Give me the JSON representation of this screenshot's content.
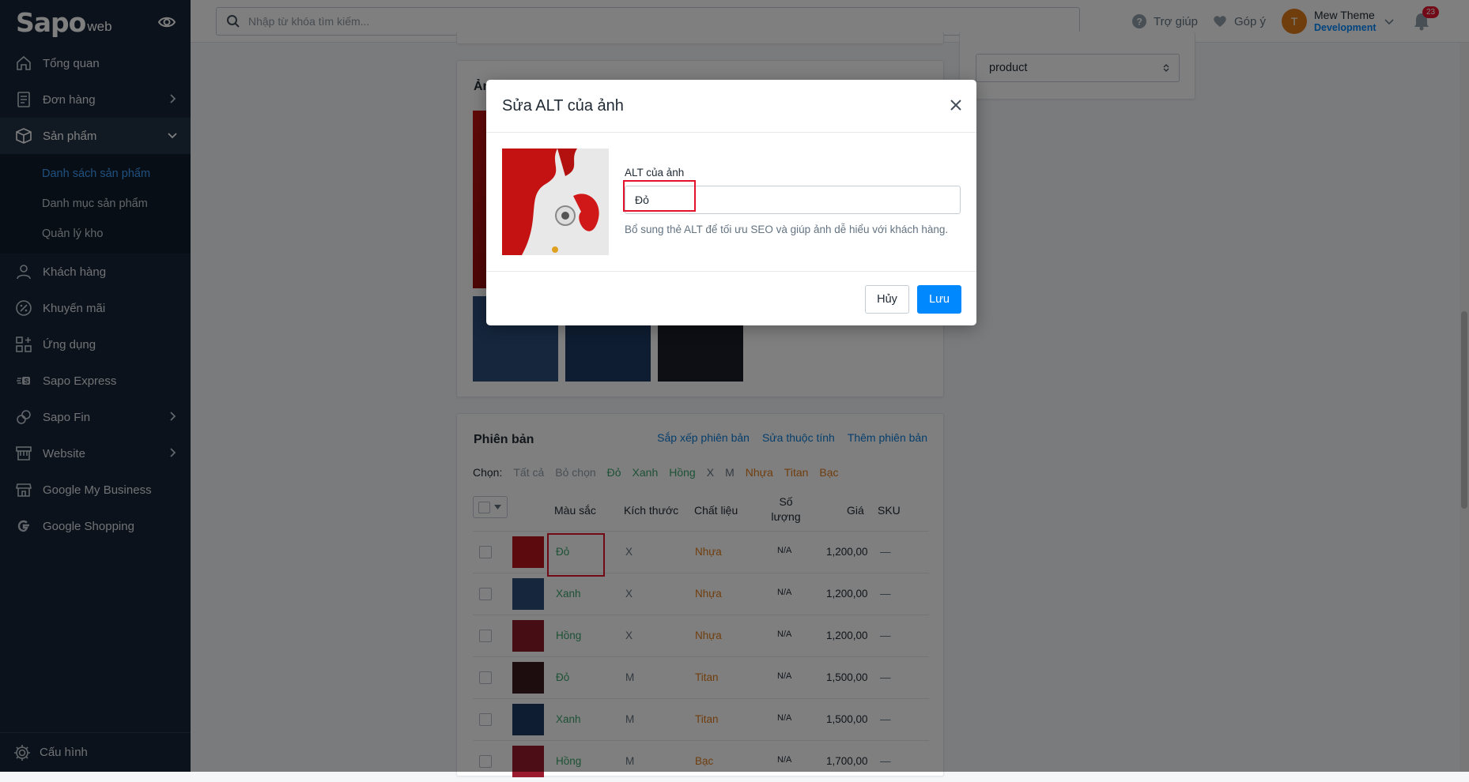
{
  "brand": {
    "name": "Sapo",
    "suffix": "web"
  },
  "sidebar": {
    "items": [
      {
        "label": "Tổng quan",
        "icon": "home-icon"
      },
      {
        "label": "Đơn hàng",
        "icon": "order-icon"
      },
      {
        "label": "Sản phẩm",
        "icon": "box-icon"
      },
      {
        "label": "Khách hàng",
        "icon": "user-icon"
      },
      {
        "label": "Khuyến mãi",
        "icon": "percent-icon"
      },
      {
        "label": "Ứng dụng",
        "icon": "apps-icon"
      },
      {
        "label": "Sapo Express",
        "icon": "express-icon"
      },
      {
        "label": "Sapo Fin",
        "icon": "fin-icon"
      },
      {
        "label": "Website",
        "icon": "website-icon"
      },
      {
        "label": "Google My Business",
        "icon": "store-icon"
      },
      {
        "label": "Google Shopping",
        "icon": "google-icon"
      }
    ],
    "sub_items": [
      "Danh sách sản phẩm",
      "Danh mục sản phẩm",
      "Quản lý kho"
    ],
    "settings": "Cấu hình"
  },
  "topbar": {
    "search_placeholder": "Nhập từ khóa tìm kiếm...",
    "help": "Trợ giúp",
    "feedback": "Góp ý",
    "user_initial": "T",
    "user_name": "Mew Theme",
    "user_role": "Development",
    "notifications": "23"
  },
  "template_select": "product",
  "images_card": {
    "title_partial": "Ản"
  },
  "variants": {
    "title": "Phiên bản",
    "actions": [
      "Sắp xếp phiên bản",
      "Sửa thuộc tính",
      "Thêm phiên bản"
    ],
    "chooser_label": "Chọn:",
    "chooser": [
      {
        "label": "Tất cả",
        "color": "#919eab"
      },
      {
        "label": "Bỏ chọn",
        "color": "#919eab"
      },
      {
        "label": "Đỏ",
        "color": "#3aa36b"
      },
      {
        "label": "Xanh",
        "color": "#3aa36b"
      },
      {
        "label": "Hồng",
        "color": "#3aa36b"
      },
      {
        "label": "X",
        "color": "#637381"
      },
      {
        "label": "M",
        "color": "#637381"
      },
      {
        "label": "Nhựa",
        "color": "#e07b1a"
      },
      {
        "label": "Titan",
        "color": "#e07b1a"
      },
      {
        "label": "Bạc",
        "color": "#e07b1a"
      }
    ],
    "columns": [
      "Màu sắc",
      "Kích thước",
      "Chất liệu",
      "Số lượng",
      "Giá",
      "SKU"
    ],
    "rows": [
      {
        "color": "Đỏ",
        "size": "X",
        "material": "Nhựa",
        "qty": "N/A",
        "price": "1,200,00",
        "sku": "—"
      },
      {
        "color": "Xanh",
        "size": "X",
        "material": "Nhựa",
        "qty": "N/A",
        "price": "1,200,00",
        "sku": "—"
      },
      {
        "color": "Hồng",
        "size": "X",
        "material": "Nhựa",
        "qty": "N/A",
        "price": "1,200,00",
        "sku": "—"
      },
      {
        "color": "Đỏ",
        "size": "M",
        "material": "Titan",
        "qty": "N/A",
        "price": "1,500,00",
        "sku": "—"
      },
      {
        "color": "Xanh",
        "size": "M",
        "material": "Titan",
        "qty": "N/A",
        "price": "1,500,00",
        "sku": "—"
      },
      {
        "color": "Hồng",
        "size": "M",
        "material": "Bạc",
        "qty": "N/A",
        "price": "1,700,00",
        "sku": "—"
      }
    ]
  },
  "modal": {
    "title": "Sửa ALT của ảnh",
    "field_label": "ALT của ảnh",
    "field_value": "Đỏ",
    "hint": "Bổ sung thẻ ALT để tối ưu SEO và giúp ảnh dễ hiểu với khách hàng.",
    "cancel": "Hủy",
    "save": "Lưu"
  },
  "colors": {
    "accent": "#0088ff",
    "sidebar": "#182537",
    "highlight": "#e3132c"
  }
}
